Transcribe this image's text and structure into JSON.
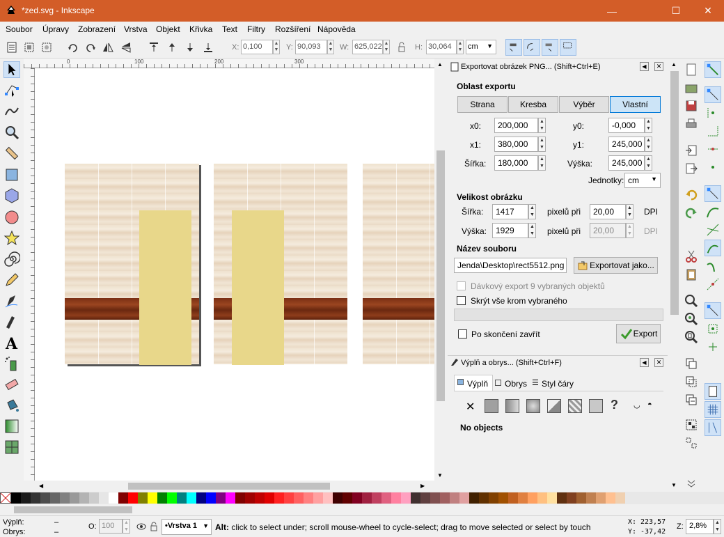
{
  "window": {
    "title": "*zed.svg - Inkscape",
    "minimize": "—",
    "maximize": "☐",
    "close": "✕"
  },
  "menu": [
    "Soubor",
    "Úpravy",
    "Zobrazení",
    "Vrstva",
    "Objekt",
    "Křivka",
    "Text",
    "Filtry",
    "Rozšíření",
    "Nápověda"
  ],
  "toolbar": {
    "x_label": "X:",
    "x_value": "0,100",
    "y_label": "Y:",
    "y_value": "90,093",
    "w_label": "W:",
    "w_value": "625,022",
    "h_label": "H:",
    "h_value": "30,064",
    "unit": "cm"
  },
  "ruler": {
    "top_ticks": [
      "0",
      "100",
      "200",
      "300"
    ]
  },
  "export_panel": {
    "title": "Exportovat obrázek PNG... (Shift+Ctrl+E)",
    "area_heading": "Oblast exportu",
    "area_buttons": [
      "Strana",
      "Kresba",
      "Výběr",
      "Vlastní"
    ],
    "x0_label": "x0:",
    "x0_value": "200,000",
    "y0_label": "y0:",
    "y0_value": "-0,000",
    "x1_label": "x1:",
    "x1_value": "380,000",
    "y1_label": "y1:",
    "y1_value": "245,000",
    "width_label": "Šířka:",
    "width_value": "180,000",
    "height_label": "Výška:",
    "height_value": "245,000",
    "units_label": "Jednotky:",
    "units_value": "cm",
    "size_heading": "Velikost obrázku",
    "img_width_label": "Šířka:",
    "img_width_value": "1417",
    "img_height_label": "Výška:",
    "img_height_value": "1929",
    "pixels_at": "pixelů při",
    "dpi_value": "20,00",
    "dpi_value2": "20,00",
    "dpi_label": "DPI",
    "filename_heading": "Název souboru",
    "filename_value": "Jenda\\Desktop\\rect5512.png",
    "export_as_button": "Exportovat jako...",
    "batch_label": "Dávkový export 9 vybraných objektů",
    "hide_label": "Skrýt vše krom vybraného",
    "close_when_done": "Po skončení zavřít",
    "export_button": "Export"
  },
  "fill_panel": {
    "title": "Výplň a obrys... (Shift+Ctrl+F)",
    "tabs": [
      "Výplň",
      "Obrys",
      "Styl čáry"
    ],
    "no_objects": "No objects",
    "unset_symbol": "?"
  },
  "status": {
    "fill_label": "Výplň:",
    "fill_value": "–",
    "stroke_label": "Obrys:",
    "stroke_value": "–",
    "opacity_label": "O:",
    "opacity_value": "100",
    "layer": "•Vrstva 1",
    "message_bold": "Alt:",
    "message": " click to select under; scroll mouse-wheel to cycle-select; drag to move selected or select by touch",
    "x_label": "X:",
    "x_value": "223,57",
    "y_label": "Y:",
    "y_value": "-37,42",
    "zoom_label": "Z:",
    "zoom_value": "2,8%"
  },
  "colors": {
    "titlebar": "#d35d28",
    "accent": "#0078d7",
    "palette": [
      "#000000",
      "#1a1a1a",
      "#333333",
      "#4d4d4d",
      "#666666",
      "#808080",
      "#999999",
      "#b3b3b3",
      "#cccccc",
      "#e6e6e6",
      "#ffffff",
      "#800000",
      "#ff0000",
      "#808000",
      "#ffff00",
      "#008000",
      "#00ff00",
      "#008080",
      "#00ffff",
      "#000080",
      "#0000ff",
      "#800080",
      "#ff00ff",
      "#800000",
      "#a00000",
      "#c00000",
      "#e00000",
      "#ff2020",
      "#ff4040",
      "#ff6060",
      "#ff8080",
      "#ffa0a0",
      "#ffc0c0",
      "#400000",
      "#600000",
      "#800020",
      "#a02040",
      "#c04060",
      "#e06080",
      "#ff80a0",
      "#ffa0c0",
      "#403030",
      "#604040",
      "#805050",
      "#a06060",
      "#c08080",
      "#e0a0a0",
      "#402000",
      "#603000",
      "#804000",
      "#a05000",
      "#c06020",
      "#e08040",
      "#ffa060",
      "#ffc080",
      "#ffe0a0",
      "#603010",
      "#804020",
      "#a06030",
      "#c08050",
      "#e0a070",
      "#ffc090",
      "#f0d0b0"
    ]
  }
}
